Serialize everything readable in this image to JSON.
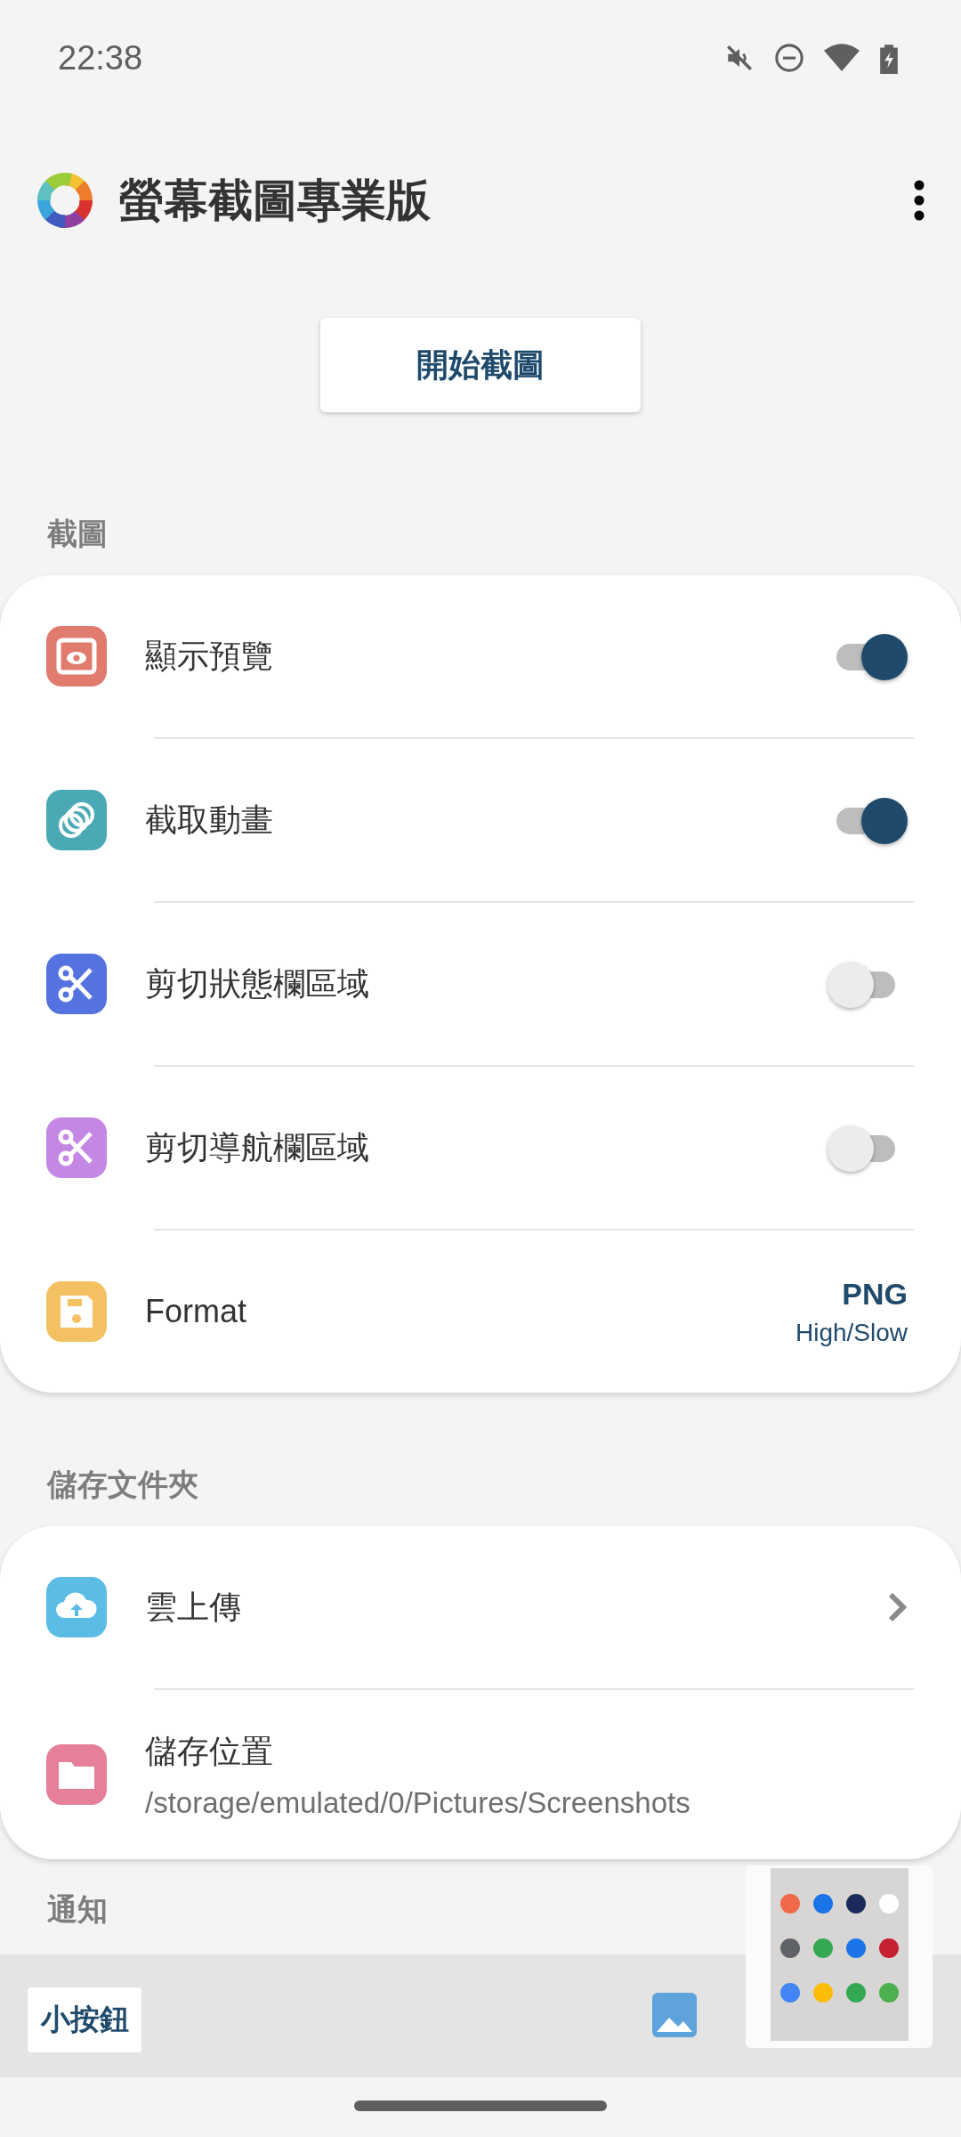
{
  "status_bar": {
    "time": "22:38"
  },
  "app_bar": {
    "title": "螢幕截圖專業版"
  },
  "start_button": {
    "label": "開始截圖"
  },
  "sections": [
    {
      "title": "截圖",
      "rows": [
        {
          "kind": "toggle",
          "label": "顯示預覽",
          "color": "#e07b6e",
          "on": true
        },
        {
          "kind": "toggle",
          "label": "截取動畫",
          "color": "#4aa9b5",
          "on": true
        },
        {
          "kind": "toggle",
          "label": "剪切狀態欄區域",
          "color": "#5472e0",
          "on": false
        },
        {
          "kind": "toggle",
          "label": "剪切導航欄區域",
          "color": "#c487e3",
          "on": false
        },
        {
          "kind": "value",
          "label": "Format",
          "color": "#f3c062",
          "value": "PNG",
          "detail": "High/Slow"
        }
      ]
    },
    {
      "title": "儲存文件夾",
      "rows": [
        {
          "kind": "link",
          "label": "雲上傳",
          "color": "#5bbde5"
        },
        {
          "kind": "path",
          "label": "儲存位置",
          "color": "#e57f9a",
          "detail": "/storage/emulated/0/Pictures/Screenshots"
        }
      ]
    },
    {
      "title": "通知"
    }
  ],
  "floating_bar": {
    "button": "小按鈕"
  }
}
